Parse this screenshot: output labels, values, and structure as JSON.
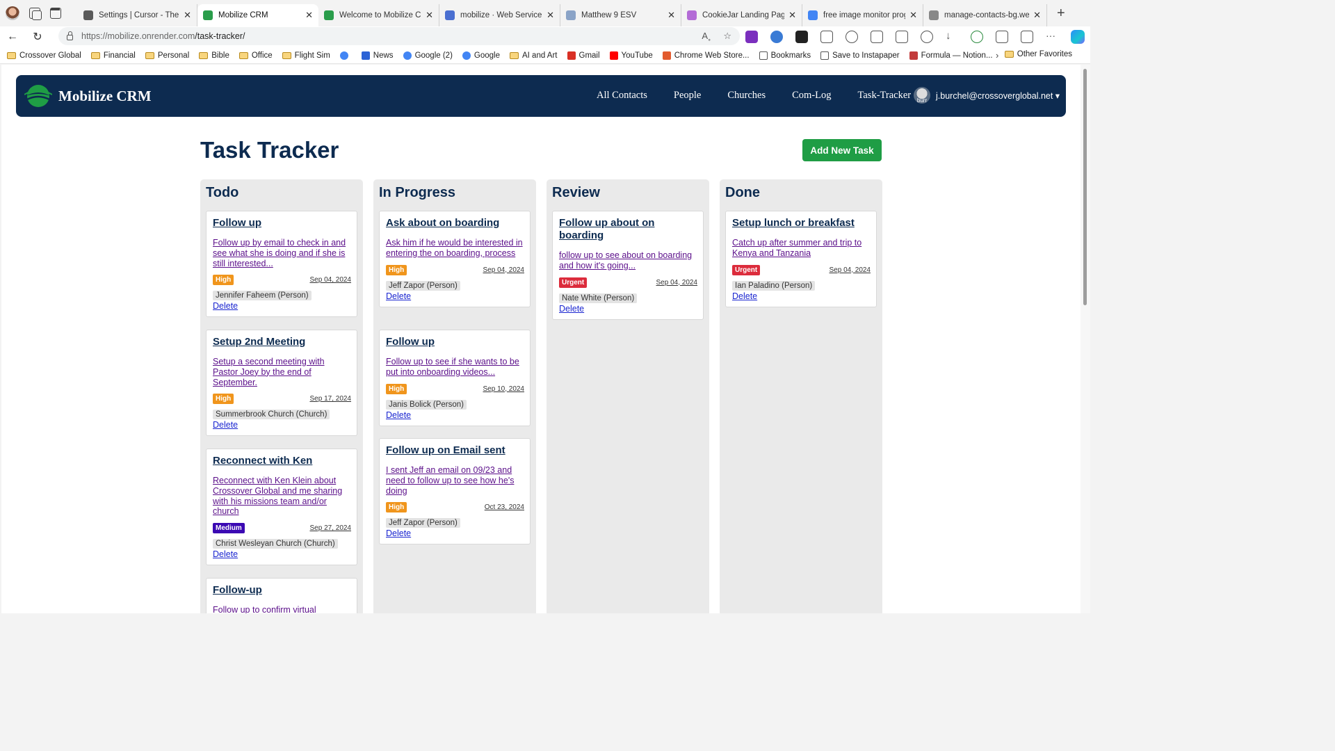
{
  "browser": {
    "tabs": [
      {
        "title": "Settings | Cursor - The AI-",
        "favicon_color": "#5a5a5a"
      },
      {
        "title": "Mobilize CRM",
        "favicon_color": "#2a9d4b",
        "active": true
      },
      {
        "title": "Welcome to Mobilize CRM",
        "favicon_color": "#2a9d4b"
      },
      {
        "title": "mobilize · Web Service ·",
        "favicon_color": "#4a6fd1"
      },
      {
        "title": "Matthew 9 ESV",
        "favicon_color": "#8aa3c7"
      },
      {
        "title": "CookieJar Landing Page In",
        "favicon_color": "#b36bd6"
      },
      {
        "title": "free image monitor progre",
        "favicon_color": "#4285f4"
      },
      {
        "title": "manage-contacts-bg.webp",
        "favicon_color": "#888888"
      }
    ],
    "url_host": "https://mobilize.onrender.com",
    "url_path": "/task-tracker/",
    "bookmarks": [
      {
        "label": "Crossover Global",
        "type": "folder"
      },
      {
        "label": "Financial",
        "type": "folder"
      },
      {
        "label": "Personal",
        "type": "folder"
      },
      {
        "label": "Bible",
        "type": "folder"
      },
      {
        "label": "Office",
        "type": "folder"
      },
      {
        "label": "Flight Sim",
        "type": "folder"
      },
      {
        "label": "",
        "type": "google"
      },
      {
        "label": "News",
        "type": "news"
      },
      {
        "label": "Google (2)",
        "type": "google"
      },
      {
        "label": "Google",
        "type": "google"
      },
      {
        "label": "AI and Art",
        "type": "folder"
      },
      {
        "label": "Gmail",
        "type": "gmail"
      },
      {
        "label": "YouTube",
        "type": "youtube"
      },
      {
        "label": "Chrome Web Store...",
        "type": "store"
      },
      {
        "label": "Bookmarks",
        "type": "page"
      },
      {
        "label": "Save to Instapaper",
        "type": "page"
      },
      {
        "label": "Formula — Notion...",
        "type": "notion"
      }
    ],
    "other_favorites": "Other Favorites"
  },
  "app": {
    "brand": "Mobilize CRM",
    "nav": [
      "All Contacts",
      "People",
      "Churches",
      "Com-Log",
      "Task-Tracker"
    ],
    "user_email": "j.burchel@crossoverglobal.net ▾",
    "avatar_alt": "burr"
  },
  "page": {
    "title": "Task Tracker",
    "add_button": "Add New Task",
    "delete_label": "Delete"
  },
  "columns": [
    {
      "name": "Todo",
      "cards": [
        {
          "title": "Follow up",
          "desc": "Follow up by email to check in and see what she is doing and if she is still interested...",
          "priority": "High",
          "date": "Sep 04, 2024",
          "contact": "Jennifer Faheem (Person)"
        },
        {
          "title": "Setup 2nd Meeting",
          "desc": "Setup a second meeting with Pastor Joey by the end of September.",
          "priority": "High",
          "date": "Sep 17, 2024",
          "contact": "Summerbrook Church (Church)"
        },
        {
          "title": "Reconnect with Ken",
          "desc": "Reconnect with Ken Klein about Crossover Global and me sharing with his missions team and/or church",
          "priority": "Medium",
          "date": "Sep 27, 2024",
          "contact": "Christ Wesleyan Church (Church)"
        },
        {
          "title": "Follow-up",
          "desc": "Follow up to confirm virtual",
          "priority": "",
          "date": "",
          "contact": ""
        }
      ]
    },
    {
      "name": "In Progress",
      "cards": [
        {
          "title": "Ask about on boarding",
          "desc": "Ask him if he would be interested in entering the on boarding, process",
          "priority": "High",
          "date": "Sep 04, 2024",
          "contact": "Jeff Zapor (Person)"
        },
        {
          "title": "Follow up",
          "desc": "Follow up to see if she wants to be put into onboarding videos...",
          "priority": "High",
          "date": "Sep 10, 2024",
          "contact": "Janis Bolick (Person)"
        },
        {
          "title": "Follow up on Email sent",
          "desc": "I sent Jeff an email on 09/23 and need to follow up to see how he's doing",
          "priority": "High",
          "date": "Oct 23, 2024",
          "contact": "Jeff Zapor (Person)"
        }
      ]
    },
    {
      "name": "Review",
      "cards": [
        {
          "title": "Follow up about on boarding",
          "desc": "follow up to see about on boarding and how it's going...",
          "priority": "Urgent",
          "date": "Sep 04, 2024",
          "contact": "Nate White (Person)"
        }
      ]
    },
    {
      "name": "Done",
      "cards": [
        {
          "title": "Setup lunch or breakfast",
          "desc": "Catch up after summer and trip to Kenya and Tanzania",
          "priority": "Urgent",
          "date": "Sep 04, 2024",
          "contact": "Ian Paladino (Person)"
        }
      ]
    }
  ],
  "colors": {
    "navy": "#0d2b50",
    "add_green": "#1f9d45",
    "high": "#f0951c",
    "urgent": "#dc2c3c",
    "medium": "#3b09b3"
  }
}
